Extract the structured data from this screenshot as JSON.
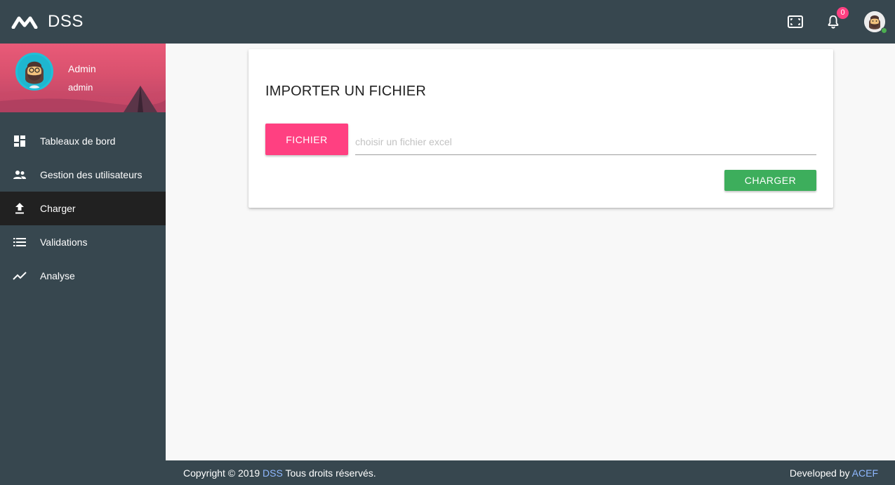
{
  "app": {
    "brand_name": "DSS"
  },
  "topbar": {
    "notification_count": "0",
    "icons": {
      "fullscreen": "fullscreen-icon",
      "notifications": "bell-icon",
      "user": "user-avatar"
    }
  },
  "sidebar": {
    "profile": {
      "name": "Admin",
      "login": "admin"
    },
    "items": [
      {
        "label": "Tableaux de bord",
        "icon": "dashboard-icon",
        "active": false
      },
      {
        "label": "Gestion des utilisateurs",
        "icon": "people-icon",
        "active": false
      },
      {
        "label": "Charger",
        "icon": "upload-icon",
        "active": true
      },
      {
        "label": "Validations",
        "icon": "list-icon",
        "active": false
      },
      {
        "label": "Analyse",
        "icon": "trending-icon",
        "active": false
      }
    ]
  },
  "main": {
    "card_title": "IMPORTER UN FICHIER",
    "file_button_label": "FICHIER",
    "file_input_value": "",
    "file_input_placeholder": "choisir un fichier excel",
    "load_button_label": "CHARGER"
  },
  "footer": {
    "copyright_prefix": "Copyright © 2019",
    "copyright_brand": "DSS",
    "copyright_suffix": "Tous droits réservés.",
    "developed_by_label": "Developed by",
    "developer": "ACEF"
  },
  "colors": {
    "topbar": "#37474f",
    "sidebar_active": "#212121",
    "file_button": "#ff4081",
    "load_button": "#3dae5c",
    "badge": "#ff4081",
    "link_accent": "#8fb8ff"
  }
}
